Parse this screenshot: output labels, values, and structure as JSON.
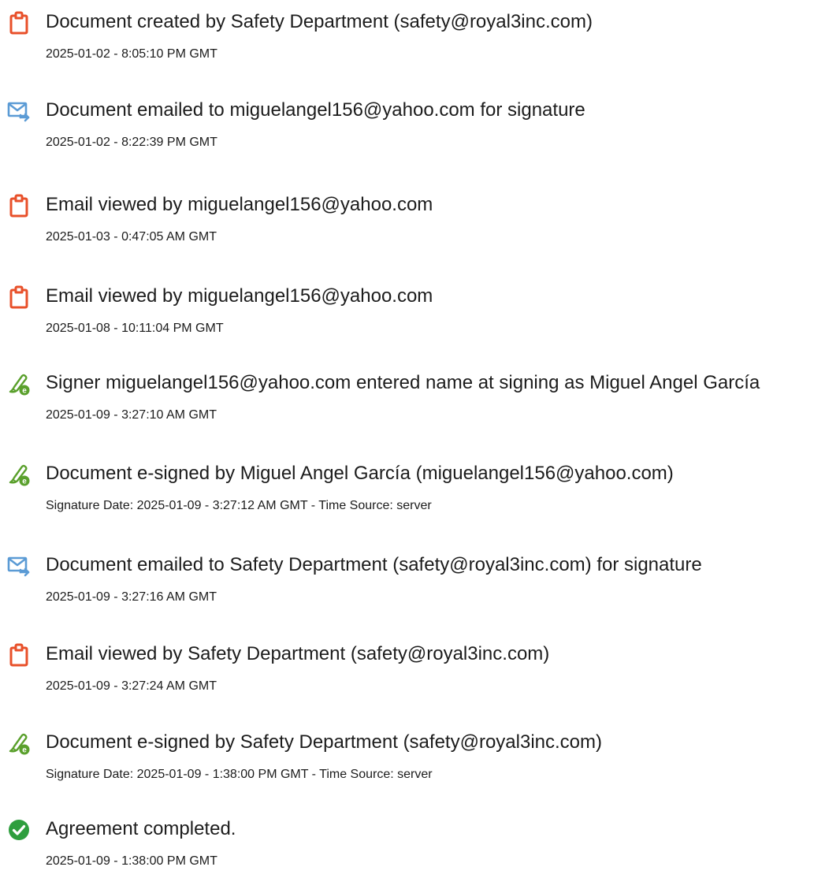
{
  "events": [
    {
      "icon": "document-created-icon",
      "title": "Document created by Safety Department (safety@royal3inc.com)",
      "timestamp": "2025-01-02 - 8:05:10 PM GMT"
    },
    {
      "icon": "email-sent-icon",
      "title": "Document emailed to miguelangel156@yahoo.com for signature",
      "timestamp": "2025-01-02 - 8:22:39 PM GMT"
    },
    {
      "icon": "email-viewed-icon",
      "title": "Email viewed by miguelangel156@yahoo.com",
      "timestamp": "2025-01-03 - 0:47:05 AM GMT"
    },
    {
      "icon": "email-viewed-icon",
      "title": "Email viewed by miguelangel156@yahoo.com",
      "timestamp": "2025-01-08 - 10:11:04 PM GMT"
    },
    {
      "icon": "e-sign-pen-icon",
      "title": "Signer miguelangel156@yahoo.com entered name at signing as Miguel Angel García",
      "timestamp": "2025-01-09 - 3:27:10 AM GMT"
    },
    {
      "icon": "e-sign-pen-icon",
      "title": "Document e-signed by Miguel Angel García (miguelangel156@yahoo.com)",
      "timestamp": "Signature Date: 2025-01-09 - 3:27:12 AM GMT - Time Source: server"
    },
    {
      "icon": "email-sent-icon",
      "title": "Document emailed to Safety Department (safety@royal3inc.com) for signature",
      "timestamp": "2025-01-09 - 3:27:16 AM GMT"
    },
    {
      "icon": "email-viewed-icon",
      "title": "Email viewed by Safety Department (safety@royal3inc.com)",
      "timestamp": "2025-01-09 - 3:27:24 AM GMT"
    },
    {
      "icon": "e-sign-pen-icon",
      "title": "Document e-signed by Safety Department (safety@royal3inc.com)",
      "timestamp": "Signature Date: 2025-01-09 - 1:38:00 PM GMT - Time Source: server"
    },
    {
      "icon": "checkmark-circle-icon",
      "title": "Agreement completed.",
      "timestamp": "2025-01-09 - 1:38:00 PM GMT"
    }
  ],
  "colors": {
    "document_orange": "#e8502a",
    "email_blue": "#5b9bd5",
    "pen_green": "#5aa02c",
    "check_green": "#2e9e3e",
    "text": "#1c1c1c"
  }
}
